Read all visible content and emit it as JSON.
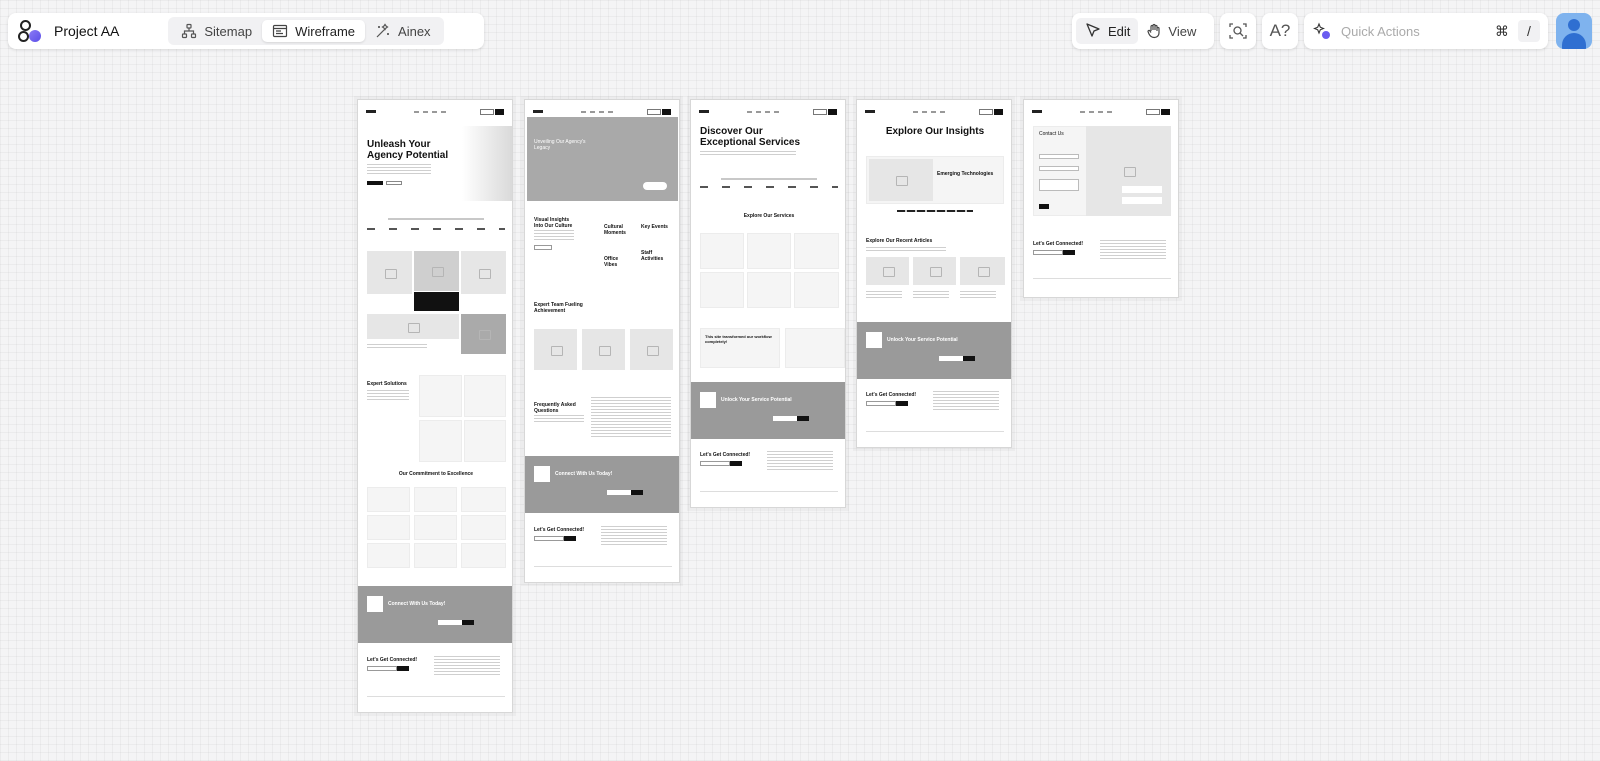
{
  "app": {
    "project_name": "Project AA",
    "brand_accent": "#6a5cf0"
  },
  "nav_tabs": [
    {
      "label": "Sitemap",
      "icon": "sitemap-icon",
      "active": false
    },
    {
      "label": "Wireframe",
      "icon": "wireframe-icon",
      "active": true
    },
    {
      "label": "Ainex",
      "icon": "ainex-icon",
      "active": false
    }
  ],
  "modes": [
    {
      "label": "Edit",
      "icon": "cursor-icon",
      "active": true
    },
    {
      "label": "View",
      "icon": "hand-icon",
      "active": false
    }
  ],
  "tools": {
    "find_icon": "find-icon",
    "font_label": "A?"
  },
  "quick_actions": {
    "placeholder": "Quick Actions",
    "shortcut_cmd": "⌘",
    "shortcut_key": "/"
  },
  "user": {
    "avatar_icon": "user-icon"
  },
  "pages": [
    {
      "headline": "Unleash Your Agency Potential",
      "sections": [
        "Expert Solutions",
        "Our Commitment to Excellence",
        "Connect With Us Today!",
        "Let's Get Connected!"
      ]
    },
    {
      "headline": "Unveiling Our Agency's Legacy",
      "sections": [
        "Visual Insights Into Our Culture",
        "Cultural Moments",
        "Key Events",
        "Office Vibes",
        "Staff Activities",
        "Expert Team Fueling Achievement",
        "Frequently Asked Questions",
        "Connect With Us Today!",
        "Let's Get Connected!"
      ]
    },
    {
      "headline": "Discover Our Exceptional Services",
      "sections": [
        "Explore Our Services",
        "This site transformed our workflow completely!",
        "Unlock Your Service Potential",
        "Let's Get Connected!"
      ]
    },
    {
      "headline": "Explore Our Insights",
      "sections": [
        "Emerging Technologies",
        "Explore Our Recent Articles",
        "Unlock Your Service Potential",
        "Let's Get Connected!"
      ]
    },
    {
      "headline": "Contact Us",
      "sections": [
        "Let's Get Connected!"
      ]
    }
  ]
}
